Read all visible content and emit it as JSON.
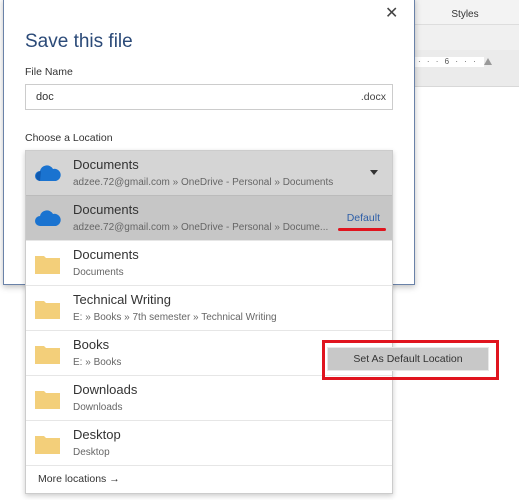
{
  "background": {
    "ribbon_label": "Styles",
    "ruler_text": "· · · 6 · · ·"
  },
  "dialog": {
    "title": "Save this file",
    "close_icon": "close-icon",
    "file_name_label": "File Name",
    "file_name_value": "doc",
    "extension": ".docx",
    "location_label": "Choose a Location",
    "selected": {
      "title": "Documents",
      "path": "adzee.72@gmail.com » OneDrive - Personal » Documents",
      "icon": "onedrive-cloud-icon"
    },
    "locations": [
      {
        "title": "Documents",
        "path": "adzee.72@gmail.com » OneDrive - Personal » Docume...",
        "icon": "onedrive-cloud-icon",
        "badge": "Default"
      },
      {
        "title": "Documents",
        "path": "Documents",
        "icon": "folder-icon"
      },
      {
        "title": "Technical Writing",
        "path": "E: » Books » 7th semester » Technical Writing",
        "icon": "folder-icon"
      },
      {
        "title": "Books",
        "path": "E: » Books",
        "icon": "folder-icon"
      },
      {
        "title": "Downloads",
        "path": "Downloads",
        "icon": "folder-icon"
      },
      {
        "title": "Desktop",
        "path": "Desktop",
        "icon": "folder-icon"
      }
    ],
    "more_locations": "More locations →"
  },
  "context_menu": {
    "set_default": "Set As Default Location"
  },
  "colors": {
    "title": "#2b4a78",
    "default_badge": "#2e5fa8",
    "highlight": "#e0141e",
    "onedrive": "#1a73d0",
    "folder": "#f3cf7a"
  }
}
